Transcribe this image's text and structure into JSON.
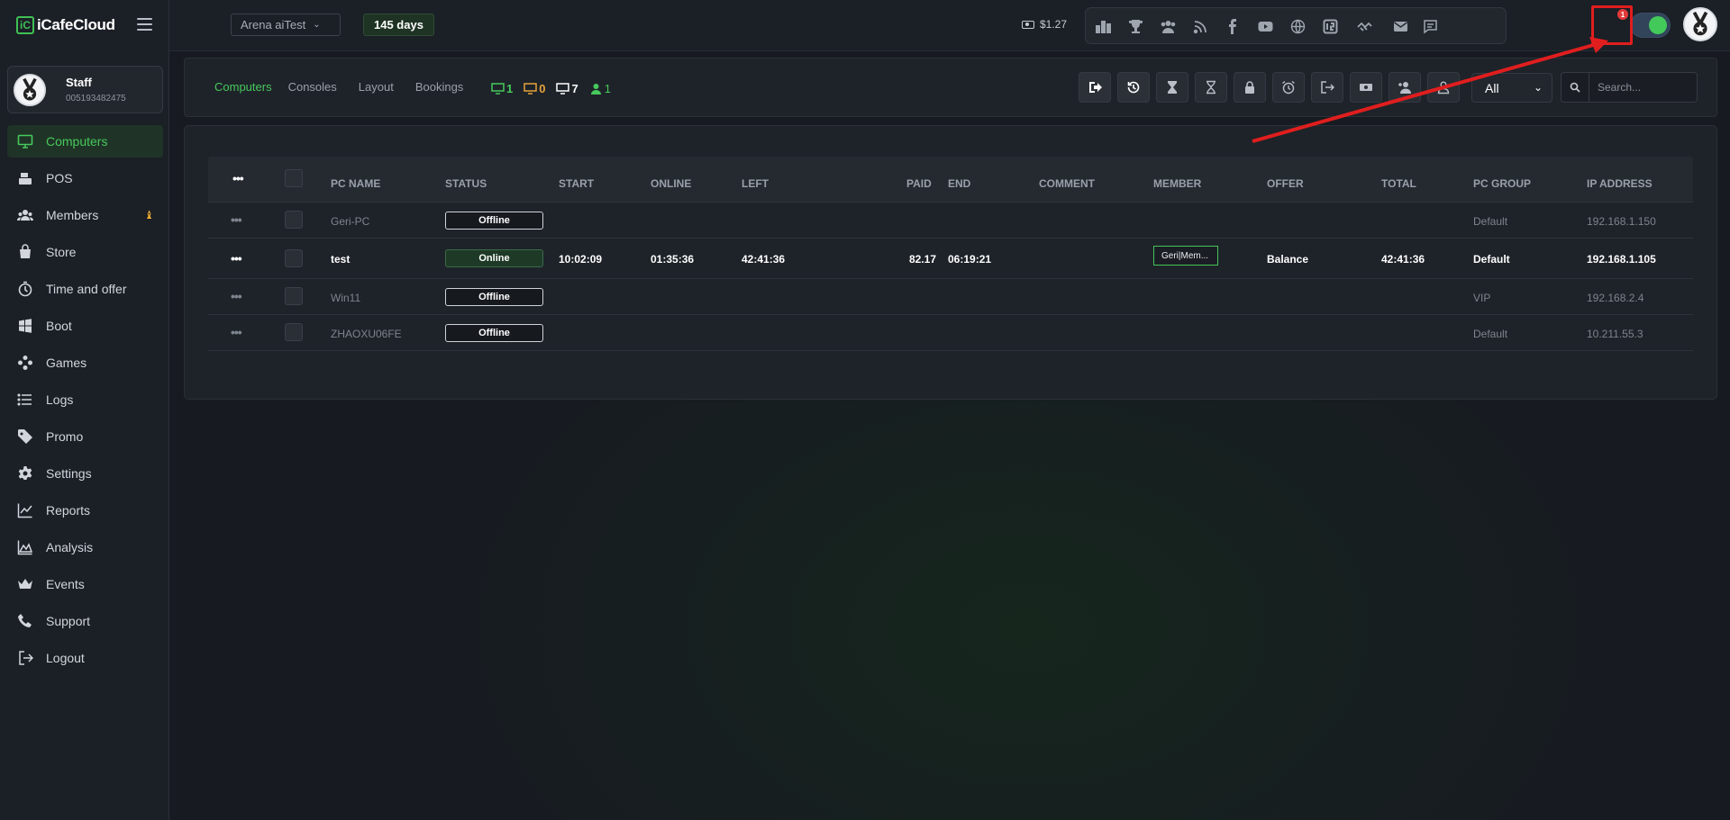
{
  "app": {
    "logo_mark": "iC",
    "logo_text": "iCafeCloud"
  },
  "staff": {
    "name": "Staff",
    "id": "005193482475"
  },
  "sidebar": {
    "items": [
      {
        "label": "Computers",
        "icon": "monitor-icon",
        "active": true
      },
      {
        "label": "POS",
        "icon": "cash-register-icon"
      },
      {
        "label": "Members",
        "icon": "users-icon",
        "badge": "♝"
      },
      {
        "label": "Store",
        "icon": "shopping-bag-icon"
      },
      {
        "label": "Time and offer",
        "icon": "stopwatch-icon"
      },
      {
        "label": "Boot",
        "icon": "windows-icon"
      },
      {
        "label": "Games",
        "icon": "gamepad-icon"
      },
      {
        "label": "Logs",
        "icon": "list-icon"
      },
      {
        "label": "Promo",
        "icon": "tag-icon"
      },
      {
        "label": "Settings",
        "icon": "gear-icon"
      },
      {
        "label": "Reports",
        "icon": "line-chart-icon"
      },
      {
        "label": "Analysis",
        "icon": "area-chart-icon"
      },
      {
        "label": "Events",
        "icon": "crown-icon"
      },
      {
        "label": "Support",
        "icon": "phone-icon"
      },
      {
        "label": "Logout",
        "icon": "logout-icon"
      }
    ]
  },
  "topbar": {
    "arena": "Arena aiTest",
    "days": "145 days",
    "balance": "$1.27",
    "notification_count": "1",
    "toggle_on": true,
    "icons": [
      "ranking-icon",
      "trophy-icon",
      "community-icon",
      "rss-icon",
      "facebook-icon",
      "youtube-icon",
      "globe-icon",
      "icafe-icon",
      "handshake-icon",
      "mail-icon",
      "chat-icon"
    ]
  },
  "subheader": {
    "tabs": [
      {
        "label": "Computers",
        "active": true
      },
      {
        "label": "Consoles"
      },
      {
        "label": "Layout"
      },
      {
        "label": "Bookings"
      }
    ],
    "counts": {
      "online": "1",
      "warning": "0",
      "offline": "7",
      "members": "1"
    },
    "actions": [
      "checkout-icon",
      "history-icon",
      "hourglass-add-icon",
      "hourglass-icon",
      "lock-icon",
      "alarm-icon",
      "logout-pc-icon",
      "cash-icon",
      "add-member-icon",
      "remove-member-icon"
    ],
    "group_select": "All",
    "search_placeholder": "Search..."
  },
  "table": {
    "headers": {
      "pc_name": "PC NAME",
      "status": "STATUS",
      "start": "START",
      "online": "ONLINE",
      "left": "LEFT",
      "paid": "PAID",
      "end": "END",
      "comment": "COMMENT",
      "member": "MEMBER",
      "offer": "OFFER",
      "total": "TOTAL",
      "pc_group": "PC GROUP",
      "ip": "IP ADDRESS"
    },
    "rows": [
      {
        "name": "Geri-PC",
        "status": "Offline",
        "start": "",
        "online": "",
        "left": "",
        "paid": "",
        "end": "",
        "comment": "",
        "member": "",
        "offer": "",
        "total": "",
        "group": "Default",
        "ip": "192.168.1.150"
      },
      {
        "name": "test",
        "status": "Online",
        "start": "10:02:09",
        "online": "01:35:36",
        "left": "42:41:36",
        "paid": "82.17",
        "end": "06:19:21",
        "comment": "",
        "member": "Geri|Mem...",
        "offer": "Balance",
        "total": "42:41:36",
        "group": "Default",
        "ip": "192.168.1.105"
      },
      {
        "name": "Win11",
        "status": "Offline",
        "start": "",
        "online": "",
        "left": "",
        "paid": "",
        "end": "",
        "comment": "",
        "member": "",
        "offer": "",
        "total": "",
        "group": "VIP",
        "ip": "192.168.2.4"
      },
      {
        "name": "ZHAOXU06FE",
        "status": "Offline",
        "start": "",
        "online": "",
        "left": "",
        "paid": "",
        "end": "",
        "comment": "",
        "member": "",
        "offer": "",
        "total": "",
        "group": "Default",
        "ip": "10.211.55.3"
      }
    ]
  },
  "colors": {
    "accent": "#47c95c",
    "warning": "#e6a23c",
    "annotation": "#e01e1e"
  }
}
